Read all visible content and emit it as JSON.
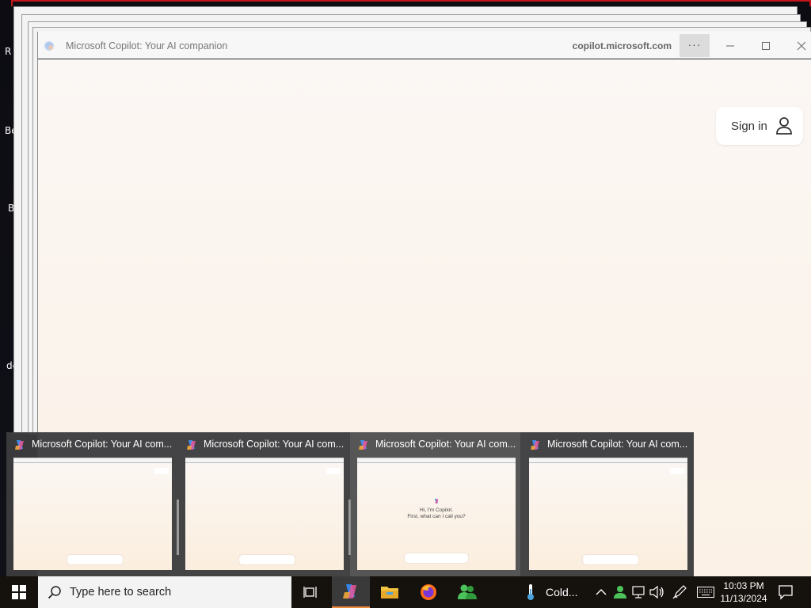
{
  "desktop": {
    "icon_labels": [
      "R",
      "Be",
      "B",
      "de"
    ]
  },
  "browser": {
    "title": "Microsoft Copilot: Your AI companion",
    "domain": "copilot.microsoft.com",
    "more_label": "···",
    "sign_in_label": "Sign in"
  },
  "thumbnails": [
    {
      "title": "Microsoft Copilot: Your AI com...",
      "kind": "blank"
    },
    {
      "title": "Microsoft Copilot: Your AI com...",
      "kind": "blank"
    },
    {
      "title": "Microsoft Copilot: Your AI com...",
      "kind": "greeting",
      "greeting_line1": "Hi, I'm Copilot.",
      "greeting_line2": "First, what can I call you?"
    },
    {
      "title": "Microsoft Copilot: Your AI com...",
      "kind": "blank"
    }
  ],
  "taskbar": {
    "search_placeholder": "Type here to search",
    "weather_text": "Cold...",
    "clock_time": "10:03 PM",
    "clock_date": "11/13/2024",
    "active_indicator_color": "#f08a3b"
  },
  "icons": {
    "start": "windows-start-icon",
    "search": "search-icon",
    "task_view": "task-view-icon",
    "copilot": "copilot-icon",
    "file_explorer": "file-explorer-icon",
    "firefox": "firefox-icon",
    "people": "people-icon",
    "weather": "thermometer-icon",
    "tray_chevron": "chevron-up-icon",
    "network": "network-icon",
    "volume": "volume-icon",
    "pen": "pen-icon",
    "keyboard": "keyboard-icon",
    "notifications": "notification-icon"
  }
}
